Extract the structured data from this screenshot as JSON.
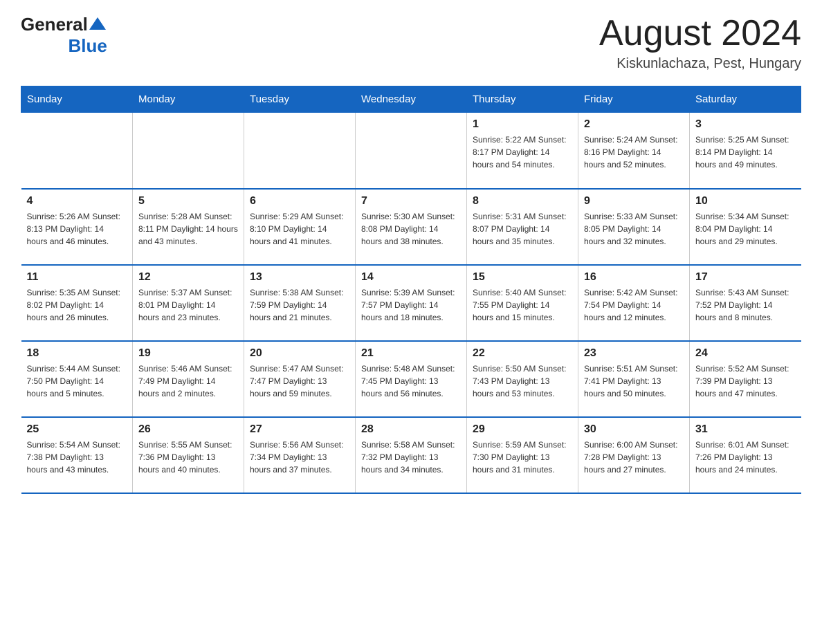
{
  "header": {
    "logo": {
      "general": "General",
      "blue": "Blue"
    },
    "title": "August 2024",
    "location": "Kiskunlachaza, Pest, Hungary"
  },
  "days_of_week": [
    "Sunday",
    "Monday",
    "Tuesday",
    "Wednesday",
    "Thursday",
    "Friday",
    "Saturday"
  ],
  "weeks": [
    [
      {
        "day": "",
        "info": ""
      },
      {
        "day": "",
        "info": ""
      },
      {
        "day": "",
        "info": ""
      },
      {
        "day": "",
        "info": ""
      },
      {
        "day": "1",
        "info": "Sunrise: 5:22 AM\nSunset: 8:17 PM\nDaylight: 14 hours and 54 minutes."
      },
      {
        "day": "2",
        "info": "Sunrise: 5:24 AM\nSunset: 8:16 PM\nDaylight: 14 hours and 52 minutes."
      },
      {
        "day": "3",
        "info": "Sunrise: 5:25 AM\nSunset: 8:14 PM\nDaylight: 14 hours and 49 minutes."
      }
    ],
    [
      {
        "day": "4",
        "info": "Sunrise: 5:26 AM\nSunset: 8:13 PM\nDaylight: 14 hours and 46 minutes."
      },
      {
        "day": "5",
        "info": "Sunrise: 5:28 AM\nSunset: 8:11 PM\nDaylight: 14 hours and 43 minutes."
      },
      {
        "day": "6",
        "info": "Sunrise: 5:29 AM\nSunset: 8:10 PM\nDaylight: 14 hours and 41 minutes."
      },
      {
        "day": "7",
        "info": "Sunrise: 5:30 AM\nSunset: 8:08 PM\nDaylight: 14 hours and 38 minutes."
      },
      {
        "day": "8",
        "info": "Sunrise: 5:31 AM\nSunset: 8:07 PM\nDaylight: 14 hours and 35 minutes."
      },
      {
        "day": "9",
        "info": "Sunrise: 5:33 AM\nSunset: 8:05 PM\nDaylight: 14 hours and 32 minutes."
      },
      {
        "day": "10",
        "info": "Sunrise: 5:34 AM\nSunset: 8:04 PM\nDaylight: 14 hours and 29 minutes."
      }
    ],
    [
      {
        "day": "11",
        "info": "Sunrise: 5:35 AM\nSunset: 8:02 PM\nDaylight: 14 hours and 26 minutes."
      },
      {
        "day": "12",
        "info": "Sunrise: 5:37 AM\nSunset: 8:01 PM\nDaylight: 14 hours and 23 minutes."
      },
      {
        "day": "13",
        "info": "Sunrise: 5:38 AM\nSunset: 7:59 PM\nDaylight: 14 hours and 21 minutes."
      },
      {
        "day": "14",
        "info": "Sunrise: 5:39 AM\nSunset: 7:57 PM\nDaylight: 14 hours and 18 minutes."
      },
      {
        "day": "15",
        "info": "Sunrise: 5:40 AM\nSunset: 7:55 PM\nDaylight: 14 hours and 15 minutes."
      },
      {
        "day": "16",
        "info": "Sunrise: 5:42 AM\nSunset: 7:54 PM\nDaylight: 14 hours and 12 minutes."
      },
      {
        "day": "17",
        "info": "Sunrise: 5:43 AM\nSunset: 7:52 PM\nDaylight: 14 hours and 8 minutes."
      }
    ],
    [
      {
        "day": "18",
        "info": "Sunrise: 5:44 AM\nSunset: 7:50 PM\nDaylight: 14 hours and 5 minutes."
      },
      {
        "day": "19",
        "info": "Sunrise: 5:46 AM\nSunset: 7:49 PM\nDaylight: 14 hours and 2 minutes."
      },
      {
        "day": "20",
        "info": "Sunrise: 5:47 AM\nSunset: 7:47 PM\nDaylight: 13 hours and 59 minutes."
      },
      {
        "day": "21",
        "info": "Sunrise: 5:48 AM\nSunset: 7:45 PM\nDaylight: 13 hours and 56 minutes."
      },
      {
        "day": "22",
        "info": "Sunrise: 5:50 AM\nSunset: 7:43 PM\nDaylight: 13 hours and 53 minutes."
      },
      {
        "day": "23",
        "info": "Sunrise: 5:51 AM\nSunset: 7:41 PM\nDaylight: 13 hours and 50 minutes."
      },
      {
        "day": "24",
        "info": "Sunrise: 5:52 AM\nSunset: 7:39 PM\nDaylight: 13 hours and 47 minutes."
      }
    ],
    [
      {
        "day": "25",
        "info": "Sunrise: 5:54 AM\nSunset: 7:38 PM\nDaylight: 13 hours and 43 minutes."
      },
      {
        "day": "26",
        "info": "Sunrise: 5:55 AM\nSunset: 7:36 PM\nDaylight: 13 hours and 40 minutes."
      },
      {
        "day": "27",
        "info": "Sunrise: 5:56 AM\nSunset: 7:34 PM\nDaylight: 13 hours and 37 minutes."
      },
      {
        "day": "28",
        "info": "Sunrise: 5:58 AM\nSunset: 7:32 PM\nDaylight: 13 hours and 34 minutes."
      },
      {
        "day": "29",
        "info": "Sunrise: 5:59 AM\nSunset: 7:30 PM\nDaylight: 13 hours and 31 minutes."
      },
      {
        "day": "30",
        "info": "Sunrise: 6:00 AM\nSunset: 7:28 PM\nDaylight: 13 hours and 27 minutes."
      },
      {
        "day": "31",
        "info": "Sunrise: 6:01 AM\nSunset: 7:26 PM\nDaylight: 13 hours and 24 minutes."
      }
    ]
  ]
}
